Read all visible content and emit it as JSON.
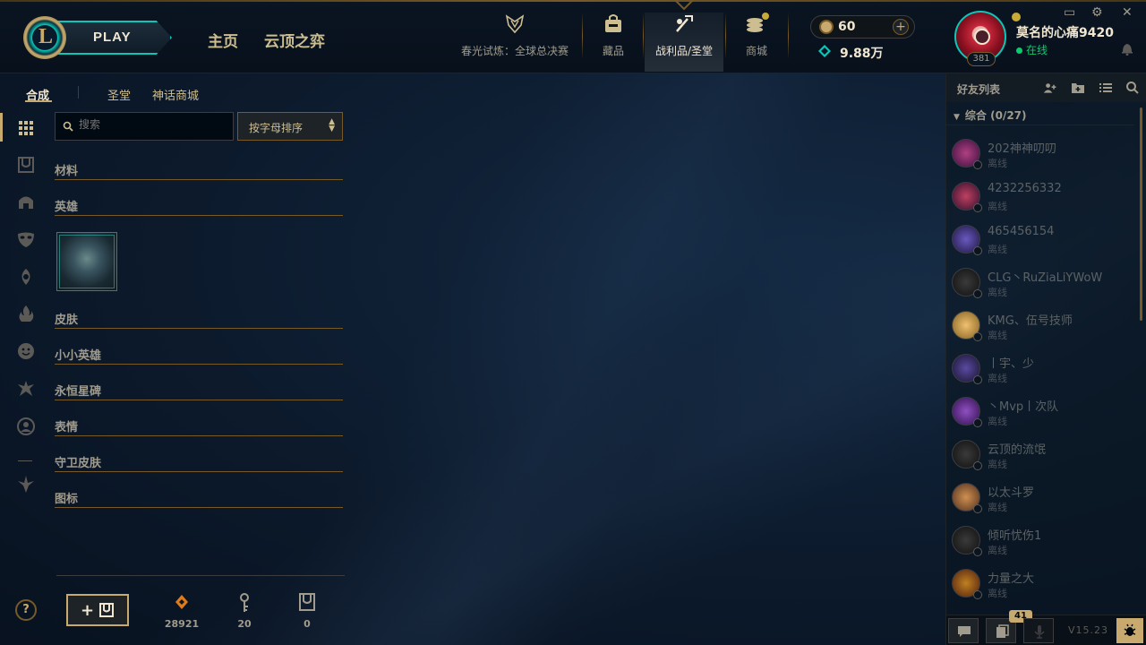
{
  "nav": {
    "play_label": "PLAY",
    "home": "主页",
    "tft": "云顶之弈",
    "event_label": "春光试炼：全球总决赛",
    "collection": "藏品",
    "loot": "战利品/圣堂",
    "store": "商城",
    "rp": "60",
    "blue_essence": "9.88万",
    "window_controls": [
      "▭",
      "⚙",
      "✕"
    ]
  },
  "profile": {
    "username": "莫名的心痛9420",
    "status": "在线",
    "level": "381"
  },
  "loot_tabs": [
    "合成",
    "圣堂",
    "神话商城"
  ],
  "search": {
    "placeholder": "搜索"
  },
  "sort": {
    "label": "按字母排序"
  },
  "sections": {
    "materials": "材料",
    "champions": "英雄",
    "skins": "皮肤",
    "little_legends": "小小英雄",
    "eternals": "永恒星碑",
    "emotes": "表情",
    "ward_skins": "守卫皮肤",
    "icons": "图标"
  },
  "bottom": {
    "help": "?",
    "orange_essence": "28921",
    "keys": "20",
    "chests": "0"
  },
  "friends": {
    "title": "好友列表",
    "group_label": "综合 (0/27)",
    "list": [
      {
        "name": "202神神叨叨",
        "status": "离线"
      },
      {
        "name": "4232256332",
        "status": "离线"
      },
      {
        "name": "465456154",
        "status": "离线"
      },
      {
        "name": "CLG丶RuZiaLiYWoW",
        "status": "离线"
      },
      {
        "name": "KMG、伍号技师",
        "status": "离线"
      },
      {
        "name": "丨宇、少",
        "status": "离线"
      },
      {
        "name": "丶Mvp丨次队",
        "status": "离线"
      },
      {
        "name": "云顶的流氓",
        "status": "离线"
      },
      {
        "name": "以太斗罗",
        "status": "离线"
      },
      {
        "name": "倾听忧伤1",
        "status": "离线"
      },
      {
        "name": "力量之大",
        "status": "离线"
      }
    ],
    "notification_count": "41",
    "version": "V15.23"
  }
}
